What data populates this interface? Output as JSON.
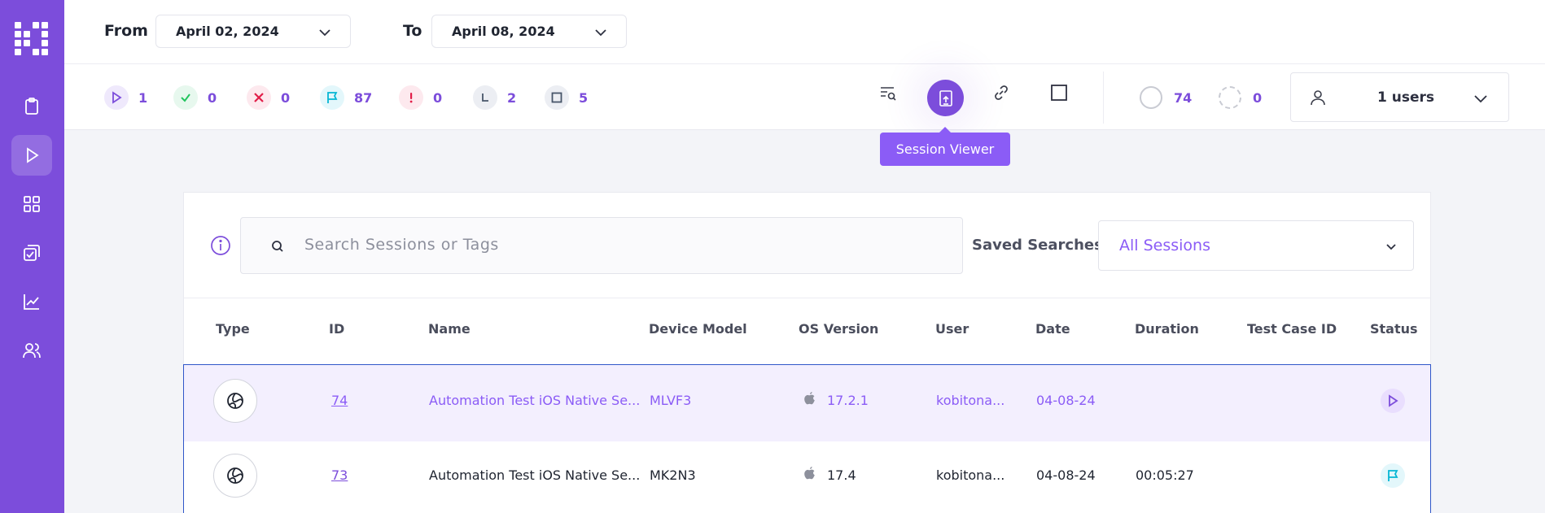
{
  "header": {
    "from_label": "From",
    "from_value": "April 02, 2024",
    "to_label": "To",
    "to_value": "April 08, 2024"
  },
  "stats": [
    {
      "icon": "play-icon",
      "value": "1",
      "color": "#7c4ddb"
    },
    {
      "icon": "check-icon",
      "value": "0",
      "color": "#22c55e"
    },
    {
      "icon": "x-icon",
      "value": "0",
      "color": "#e11d48"
    },
    {
      "icon": "flag-icon",
      "value": "87",
      "color": "#06b6d4"
    },
    {
      "icon": "exclamation-icon",
      "value": "0",
      "color": "#e11d48"
    },
    {
      "icon": "clock-icon",
      "value": "2",
      "color": "#64748b"
    },
    {
      "icon": "stop-icon",
      "value": "5",
      "color": "#475569"
    }
  ],
  "toolbar": {
    "tooltip": "Session Viewer",
    "count_solid": "74",
    "count_dashed": "0",
    "users_label": "1 users"
  },
  "search": {
    "placeholder": "Search Sessions or Tags",
    "saved_label": "Saved Searches",
    "saved_value": "All Sessions"
  },
  "table": {
    "headers": [
      "Type",
      "ID",
      "Name",
      "Device Model",
      "OS Version",
      "User",
      "Date",
      "Duration",
      "Test Case ID",
      "Status"
    ],
    "rows": [
      {
        "id": "74",
        "name": "Automation Test iOS Native Se...",
        "device": "MLVF3",
        "os": "17.2.1",
        "user": "kobitona...",
        "date": "04-08-24",
        "duration": "",
        "test_case": "",
        "status": "running"
      },
      {
        "id": "73",
        "name": "Automation Test iOS Native Se...",
        "device": "MK2N3",
        "os": "17.4",
        "user": "kobitona...",
        "date": "04-08-24",
        "duration": "00:05:27",
        "test_case": "",
        "status": "flagged"
      }
    ]
  },
  "colors": {
    "accent": "#7c4ddb",
    "selected_row": "#f3effe",
    "row_border": "#2f56c9"
  }
}
